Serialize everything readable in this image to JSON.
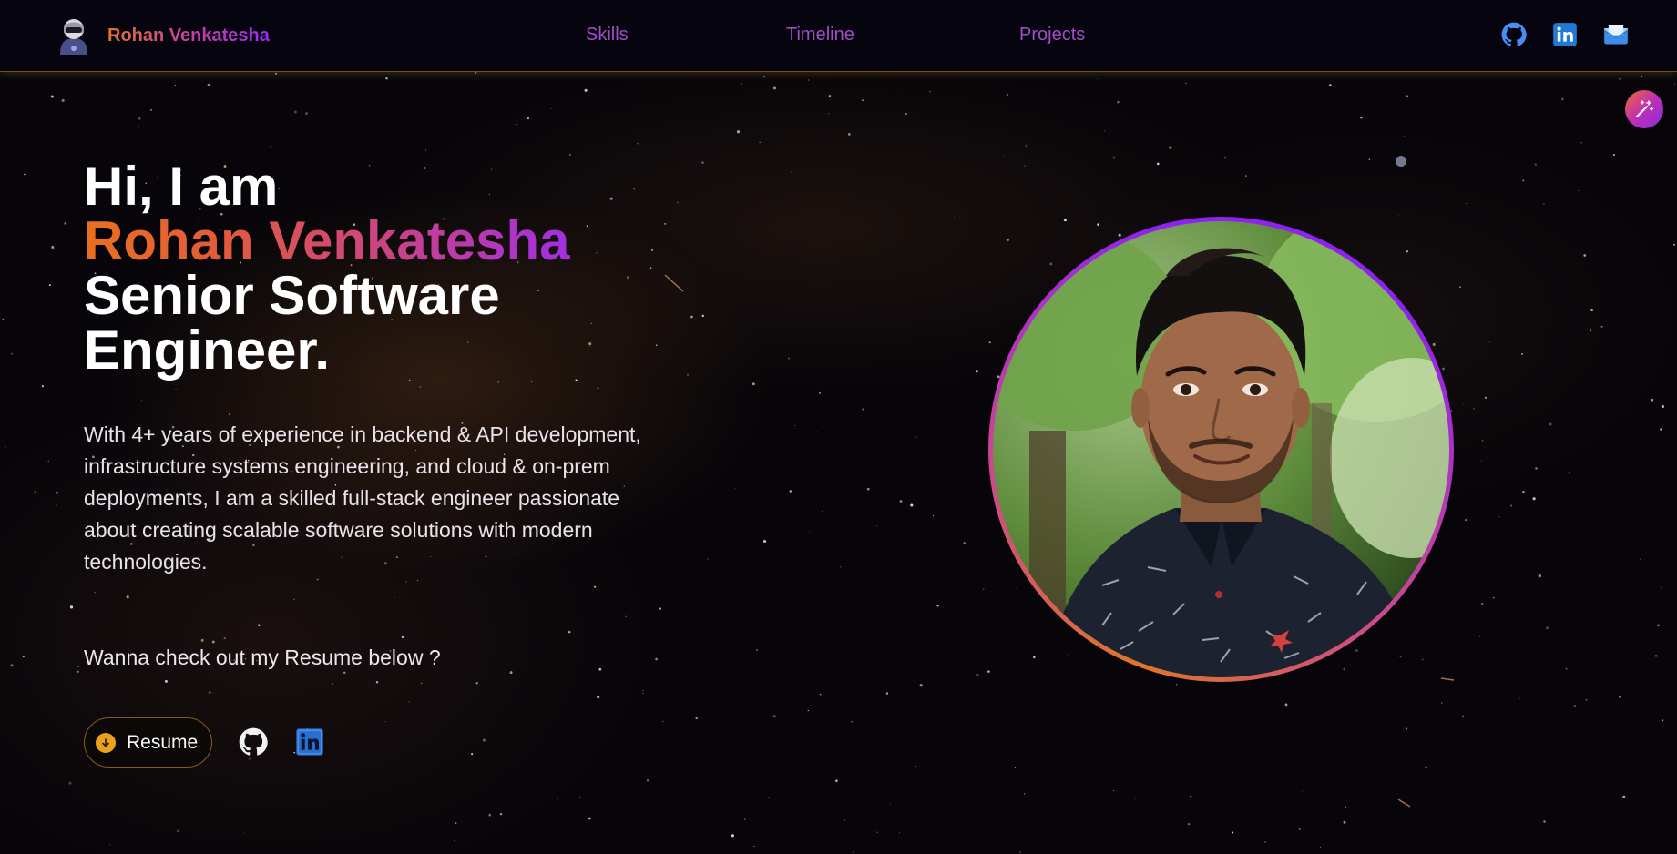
{
  "nav": {
    "brand": "Rohan Venkatesha",
    "links": [
      "Skills",
      "Timeline",
      "Projects"
    ]
  },
  "hero": {
    "greeting": "Hi, I am",
    "name": "Rohan Venkatesha",
    "title_line1": "Senior Software",
    "title_line2": "Engineer.",
    "description": "With 4+ years of experience in backend & API development, infrastructure systems engineering, and cloud & on-prem deployments, I am a skilled full-stack engineer passionate about creating scalable software solutions with modern technologies.",
    "cta": "Wanna check out my Resume below ?",
    "resume_label": "Resume"
  },
  "icons": {
    "nav": [
      "github-icon",
      "linkedin-icon",
      "mail-icon"
    ],
    "hero": [
      "github-icon",
      "linkedin-icon"
    ],
    "magic": "magic-wand-icon",
    "download": "download-icon"
  },
  "colors": {
    "nav_link": "#a24ec6",
    "gradient_start": "#e8701e",
    "gradient_mid": "#c7418f",
    "gradient_end": "#9a2cf3",
    "resume_icon": "#e8a21e"
  }
}
